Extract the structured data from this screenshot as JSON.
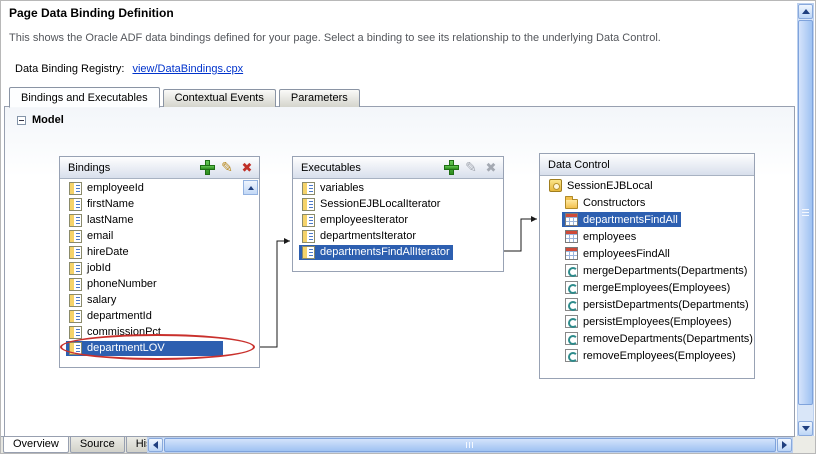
{
  "header": {
    "title": "Page Data Binding Definition",
    "description": "This shows the Oracle ADF data bindings defined for your page. Select a binding to see its relationship to the underlying Data Control.",
    "registry_label": "Data Binding Registry:",
    "registry_link": "view/DataBindings.cpx"
  },
  "tabs": [
    {
      "label": "Bindings and Executables",
      "active": true
    },
    {
      "label": "Contextual Events",
      "active": false
    },
    {
      "label": "Parameters",
      "active": false
    }
  ],
  "model_section": {
    "label": "Model",
    "collapsed": false
  },
  "bindings_panel": {
    "title": "Bindings",
    "items": [
      "employeeId",
      "firstName",
      "lastName",
      "email",
      "hireDate",
      "jobId",
      "phoneNumber",
      "salary",
      "departmentId",
      "commissionPct",
      "departmentLOV"
    ],
    "selected_item": "departmentLOV",
    "annotation_target": "departmentLOV"
  },
  "executables_panel": {
    "title": "Executables",
    "items": [
      "variables",
      "SessionEJBLocalIterator",
      "employeesIterator",
      "departmentsIterator",
      "departmentsFindAllIterator"
    ],
    "selected_item": "departmentsFindAllIterator"
  },
  "data_control_panel": {
    "title": "Data Control",
    "root_item": "SessionEJBLocal",
    "children": [
      "Constructors",
      "departmentsFindAll",
      "employees",
      "employeesFindAll",
      "mergeDepartments(Departments)",
      "mergeEmployees(Employees)",
      "persistDepartments(Departments)",
      "persistEmployees(Employees)",
      "removeDepartments(Departments)",
      "removeEmployees(Employees)"
    ],
    "selected_item": "departmentsFindAll"
  },
  "bottom_tabs": [
    {
      "label": "Overview",
      "active": true
    },
    {
      "label": "Source",
      "active": false
    },
    {
      "label": "History",
      "active": false
    }
  ],
  "colors": {
    "selection_blue": "#2d5fb0",
    "link_blue": "#0033cc",
    "annotation_red": "#c9302c",
    "add_green": "#2e8e1e",
    "delete_red": "#c03028"
  },
  "icons": {
    "toolbar": [
      "add-icon",
      "pencil-icon",
      "delete-x-icon"
    ],
    "tree": [
      "ejb-session-icon",
      "folder-icon",
      "collection-icon",
      "method-icon"
    ]
  }
}
